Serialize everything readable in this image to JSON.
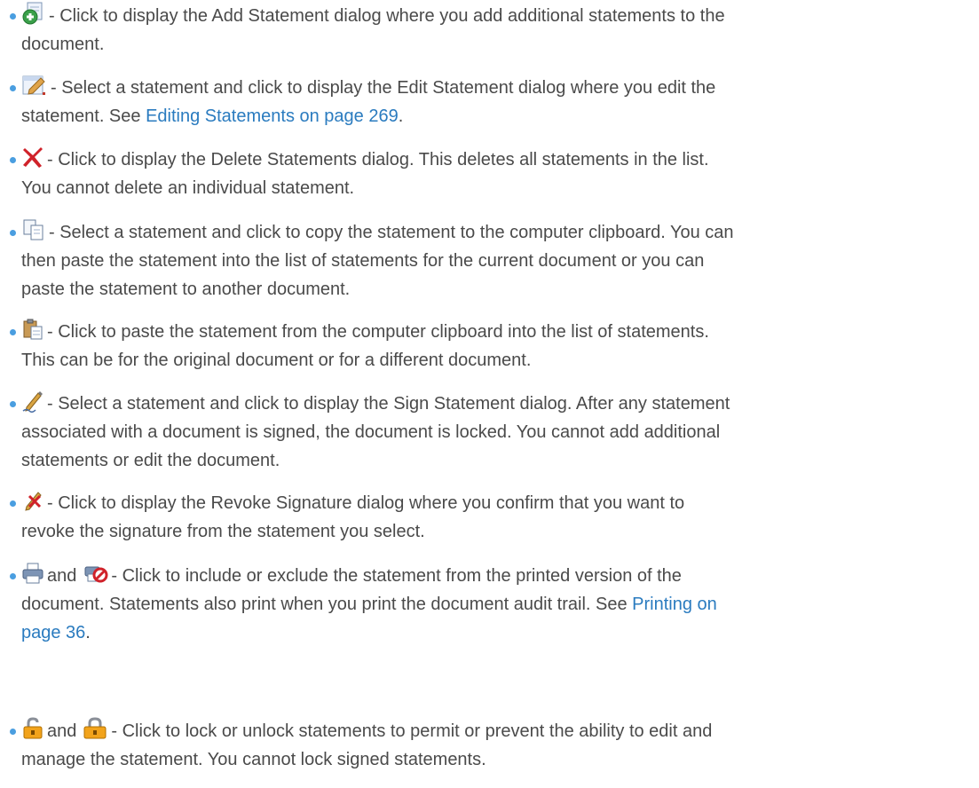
{
  "items": [
    {
      "icon": "add-statement-icon",
      "text_1": "- Click to display the Add Statement dialog where you add additional statements to the",
      "text_2": "document."
    },
    {
      "icon": "edit-statement-icon",
      "text_1": "- Select a statement and click to display the Edit Statement dialog where you edit the",
      "text_2_prefix": "statement. See ",
      "link": "Editing Statements on page 269",
      "text_2_suffix": "."
    },
    {
      "icon": "delete-icon",
      "text_1": "- Click to display the Delete Statements dialog. This deletes all statements in the list.",
      "text_2": "You cannot delete an individual statement."
    },
    {
      "icon": "copy-icon",
      "text_1": "- Select a statement and click to copy the statement to the computer clipboard. You can",
      "text_2": "then paste the statement into the list of statements for the current document or you can",
      "text_3": "paste the statement to another document."
    },
    {
      "icon": "paste-icon",
      "text_1": "- Click to paste the statement from the computer clipboard into the list of statements.",
      "text_2": "This can be for the original document or for a different document."
    },
    {
      "icon": "sign-icon",
      "text_1": "- Select a statement and click to display the Sign Statement dialog. After any statement",
      "text_2": "associated with a document is signed, the document is locked. You cannot add additional",
      "text_3": "statements or edit the document."
    },
    {
      "icon": "revoke-signature-icon",
      "text_1": "- Click to display the Revoke Signature dialog where you confirm that you want to",
      "text_2": "revoke the signature from the statement you select."
    },
    {
      "icon_a": "print-include-icon",
      "and": "and",
      "icon_b": "print-exclude-icon",
      "text_1": "- Click to include or exclude the statement from the printed version of the",
      "text_2": "document. Statements also print when you print the document audit trail. See ",
      "link": "Printing on",
      "link_2": "page 36",
      "text_3_suffix": "."
    },
    {
      "icon_a": "unlock-icon",
      "and": "and",
      "icon_b": "lock-icon",
      "text_1": "- Click to lock or unlock statements to permit or prevent the ability to edit and",
      "text_2": "manage the statement. You cannot lock signed statements."
    }
  ],
  "colors": {
    "text": "#4a4a4a",
    "link": "#2a7bbf",
    "bullet": "#4a9ee0"
  }
}
